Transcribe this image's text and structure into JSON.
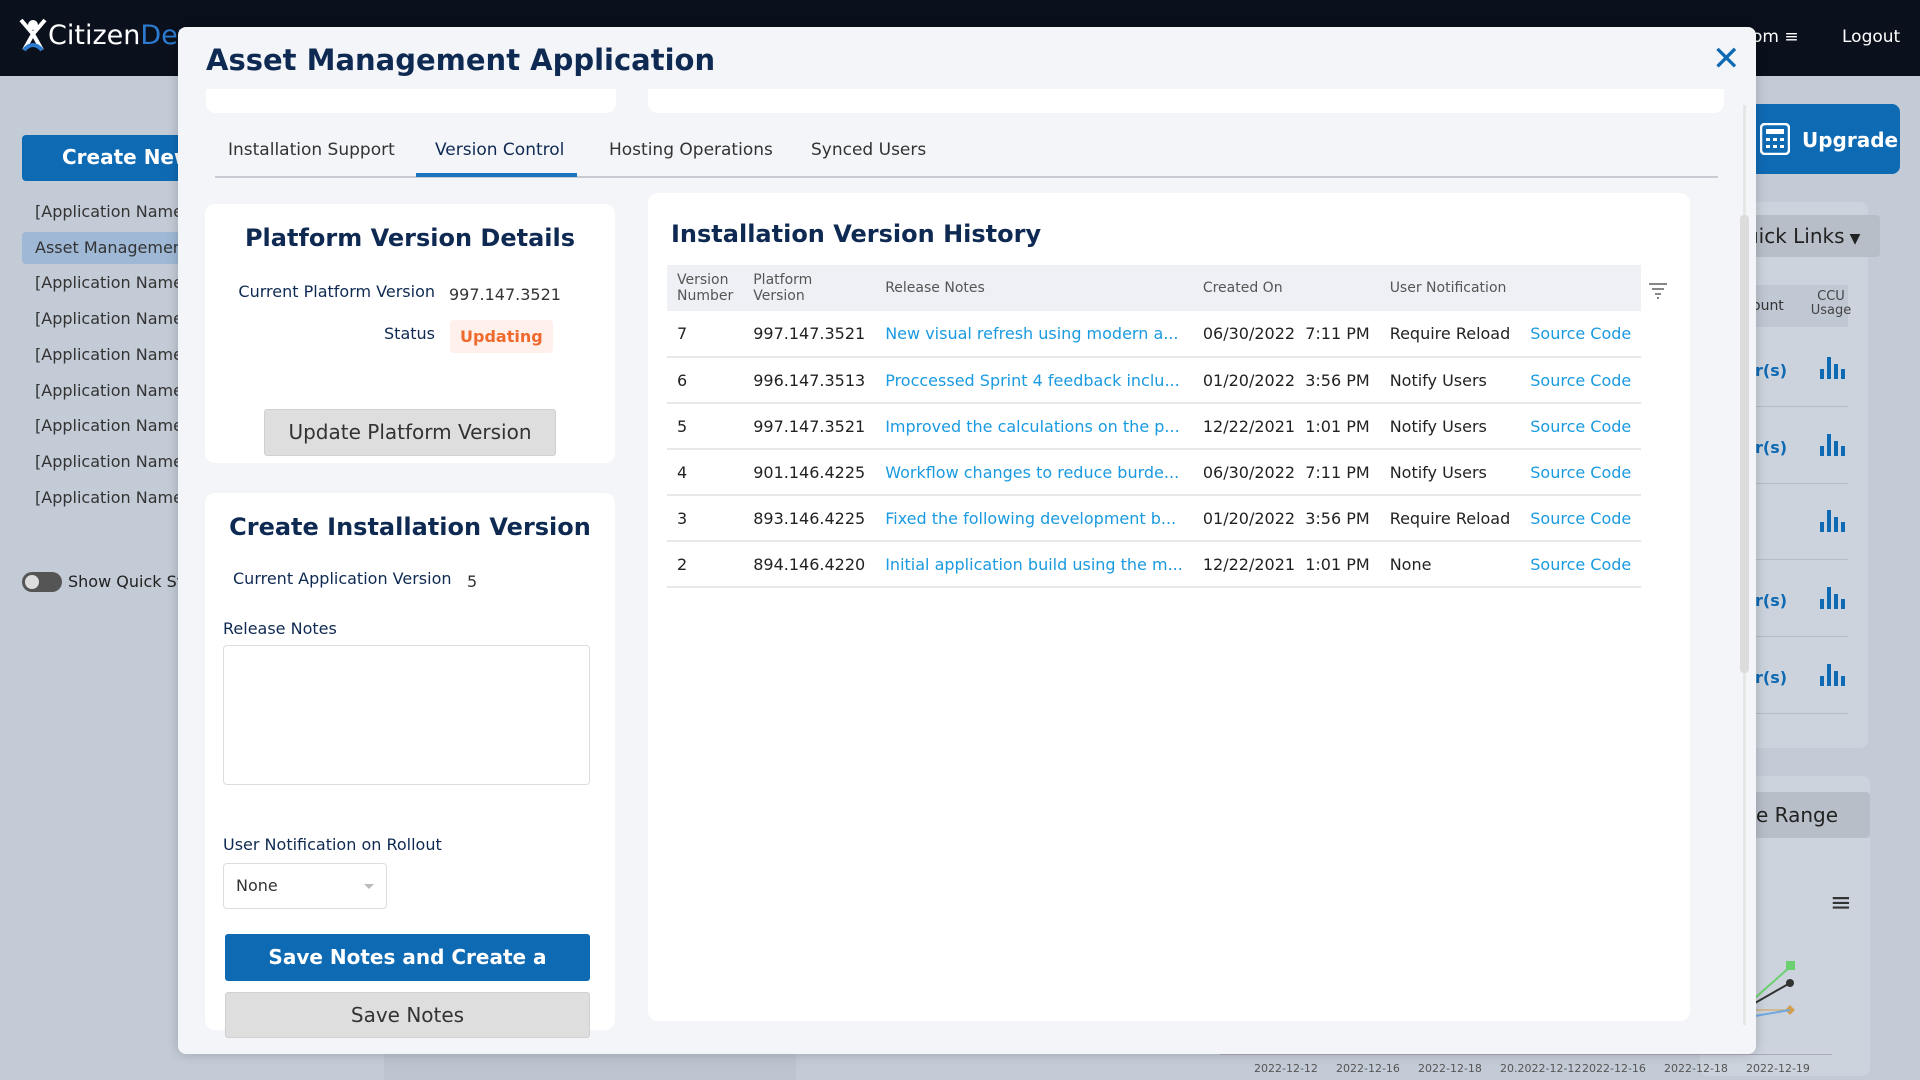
{
  "header": {
    "logo": {
      "part1": "Citizen",
      "part2": "Dev"
    },
    "nav_fragment": "om",
    "logout": "Logout"
  },
  "sidebar": {
    "create_new": "Create New",
    "items": [
      {
        "label": "[Application Name]"
      },
      {
        "label": "Asset Management Application",
        "active": true
      },
      {
        "label": "[Application Name]"
      },
      {
        "label": "[Application Name]"
      },
      {
        "label": "[Application Name]"
      },
      {
        "label": "[Application Name]"
      },
      {
        "label": "[Application Name]"
      },
      {
        "label": "[Application Name]"
      },
      {
        "label": "[Application Name]"
      }
    ],
    "toggle_label": "Show Quick Stats",
    "toggle_on": false
  },
  "background": {
    "upgrade": "Upgrade",
    "quick_links": "uick Links",
    "col_count": "ount",
    "col_ccu": "CCU Usage",
    "user_frag": "r(s)",
    "range": "e Range",
    "dates": [
      "2022-12-12",
      "2022-12-16",
      "2022-12-18",
      "20.2022-12-12",
      "2022-12-16",
      "2022-12-18",
      "2022-12-19"
    ]
  },
  "modal": {
    "title": "Asset Management Application",
    "tabs": [
      {
        "label": "Installation Support"
      },
      {
        "label": "Version Control",
        "active": true
      },
      {
        "label": "Hosting Operations"
      },
      {
        "label": "Synced Users"
      }
    ],
    "platform": {
      "title": "Platform Version Details",
      "current_label": "Current Platform Version",
      "current_value": "997.147.3521",
      "status_label": "Status",
      "status_value": "Updating",
      "update_button": "Update Platform Version"
    },
    "create": {
      "title": "Create Installation Version",
      "app_version_label": "Current Application Version",
      "app_version_value": "5",
      "release_notes_label": "Release Notes",
      "release_notes_value": "",
      "notification_label": "User Notification on Rollout",
      "notification_value": "None",
      "primary_button": "Save Notes and Create a Version",
      "secondary_button": "Save Notes"
    },
    "history": {
      "title": "Installation Version History",
      "columns": [
        "Version Number",
        "Platform Version",
        "Release Notes",
        "Created On",
        "User Notification",
        ""
      ],
      "rows": [
        {
          "version": "7",
          "platform": "997.147.3521",
          "notes": "New visual refresh using modern a...",
          "created": "06/30/2022  7:11 PM",
          "notification": "Require Reload",
          "link": "Source Code"
        },
        {
          "version": "6",
          "platform": "996.147.3513",
          "notes": "Proccessed Sprint 4 feedback inclu...",
          "created": "01/20/2022  3:56 PM",
          "notification": "Notify Users",
          "link": "Source Code"
        },
        {
          "version": "5",
          "platform": "997.147.3521",
          "notes": "Improved the calculations on the p...",
          "created": "12/22/2021  1:01 PM",
          "notification": "Notify Users",
          "link": "Source Code"
        },
        {
          "version": "4",
          "platform": "901.146.4225",
          "notes": "Workflow changes to reduce burde...",
          "created": "06/30/2022  7:11 PM",
          "notification": "Notify Users",
          "link": "Source Code"
        },
        {
          "version": "3",
          "platform": "893.146.4225",
          "notes": "Fixed the following development b...",
          "created": "01/20/2022  3:56 PM",
          "notification": "Require Reload",
          "link": "Source Code"
        },
        {
          "version": "2",
          "platform": "894.146.4220",
          "notes": "Initial application build using the m...",
          "created": "12/22/2021  1:01 PM",
          "notification": "None",
          "link": "Source Code"
        }
      ]
    }
  },
  "colors": {
    "brand": "#0f6ab4",
    "title": "#0f2a52",
    "status_updating": "#f06a2e",
    "link": "#1a9ae0"
  }
}
